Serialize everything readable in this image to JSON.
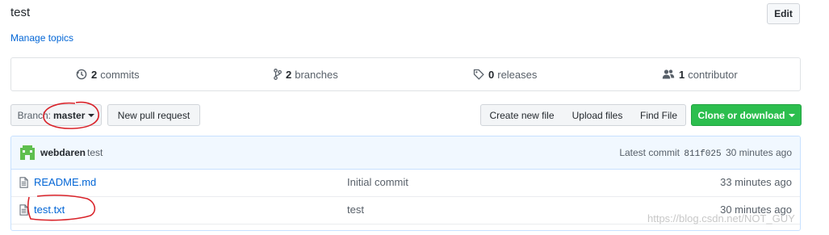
{
  "repo": {
    "description": "test",
    "manage_topics": "Manage topics",
    "edit_label": "Edit"
  },
  "summary": {
    "commits_count": "2",
    "commits_label": "commits",
    "branches_count": "2",
    "branches_label": "branches",
    "releases_count": "0",
    "releases_label": "releases",
    "contributors_count": "1",
    "contributors_label": "contributor"
  },
  "toolbar": {
    "branch_label": "Branch:",
    "branch_value": "master",
    "new_pr_label": "New pull request",
    "create_file_label": "Create new file",
    "upload_files_label": "Upload files",
    "find_file_label": "Find File",
    "clone_label": "Clone or download"
  },
  "latest_commit": {
    "author": "webdaren",
    "message": "test",
    "prefix": "Latest commit",
    "sha": "811f025",
    "age": "30 minutes ago"
  },
  "files": [
    {
      "name": "README.md",
      "message": "Initial commit",
      "age": "33 minutes ago"
    },
    {
      "name": "test.txt",
      "message": "test",
      "age": "30 minutes ago"
    }
  ],
  "watermark": "https://blog.csdn.net/NOT_GUY",
  "colors": {
    "link": "#0366d6",
    "clone_button": "#2cbe4e",
    "commit_bar": "#f1f8ff",
    "annotation": "#d9232a"
  },
  "icons": {
    "commits": "history-icon",
    "branches": "git-branch-icon",
    "releases": "tag-icon",
    "contributors": "people-icon",
    "file": "file-text-icon"
  }
}
